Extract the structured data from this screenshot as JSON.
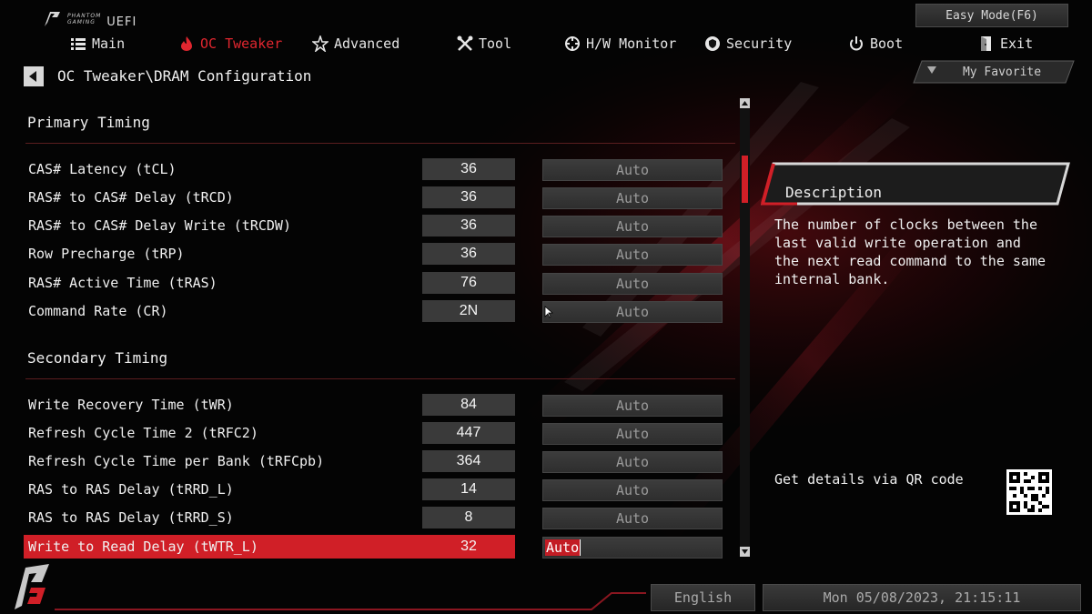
{
  "logo": {
    "brand_line1": "PHANTOM",
    "brand_line2": "GAMING",
    "uefi": "UEFI"
  },
  "easy_mode": {
    "label": "Easy Mode(F6)"
  },
  "nav": {
    "items": [
      {
        "label": "Main",
        "icon": "list-icon"
      },
      {
        "label": "OC Tweaker",
        "icon": "flame-icon",
        "active": true
      },
      {
        "label": "Advanced",
        "icon": "star-icon"
      },
      {
        "label": "Tool",
        "icon": "wrench-icon"
      },
      {
        "label": "H/W Monitor",
        "icon": "crosshair-icon"
      },
      {
        "label": "Security",
        "icon": "shield-icon"
      },
      {
        "label": "Boot",
        "icon": "power-icon"
      },
      {
        "label": "Exit",
        "icon": "exit-door-icon"
      }
    ]
  },
  "breadcrumb": "OC Tweaker\\DRAM Configuration",
  "favorite": {
    "label": "My Favorite"
  },
  "sections": [
    {
      "title": "Primary Timing",
      "rows": [
        {
          "label": "CAS# Latency (tCL)",
          "current": "36",
          "setting": "Auto"
        },
        {
          "label": "RAS# to CAS# Delay (tRCD)",
          "current": "36",
          "setting": "Auto"
        },
        {
          "label": "RAS# to CAS# Delay Write (tRCDW)",
          "current": "36",
          "setting": "Auto"
        },
        {
          "label": "Row Precharge (tRP)",
          "current": "36",
          "setting": "Auto"
        },
        {
          "label": "RAS# Active Time (tRAS)",
          "current": "76",
          "setting": "Auto"
        },
        {
          "label": "Command Rate (CR)",
          "current": "2N",
          "setting": "Auto"
        }
      ]
    },
    {
      "title": "Secondary Timing",
      "rows": [
        {
          "label": "Write Recovery Time (tWR)",
          "current": "84",
          "setting": "Auto"
        },
        {
          "label": "Refresh Cycle Time 2 (tRFC2)",
          "current": "447",
          "setting": "Auto"
        },
        {
          "label": "Refresh Cycle Time per Bank (tRFCpb)",
          "current": "364",
          "setting": "Auto"
        },
        {
          "label": "RAS to RAS Delay (tRRD_L)",
          "current": "14",
          "setting": "Auto"
        },
        {
          "label": "RAS to RAS Delay (tRRD_S)",
          "current": "8",
          "setting": "Auto"
        },
        {
          "label": "Write to Read Delay (tWTR_L)",
          "current": "32",
          "setting": "Auto",
          "selected": true
        }
      ]
    }
  ],
  "description": {
    "title": "Description",
    "text": "The number of clocks between the last valid write operation and the next read command to the same internal bank.",
    "qr_label": "Get details via QR code"
  },
  "footer": {
    "language": "English",
    "datetime": "Mon 05/08/2023, 21:15:11"
  },
  "colors": {
    "accent": "#d01f27",
    "panel": "#3a3a3a",
    "text": "#f0f0f0"
  }
}
